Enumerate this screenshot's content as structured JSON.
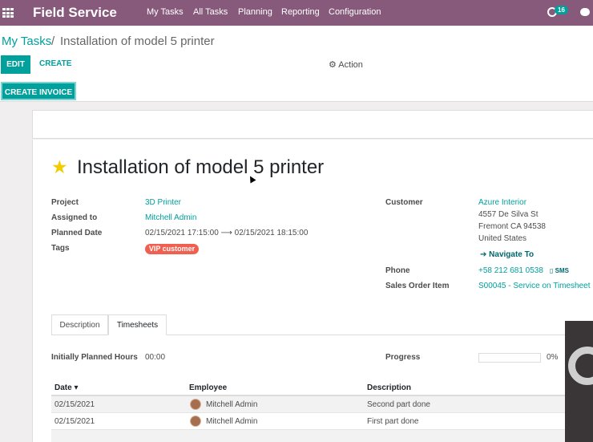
{
  "topbar": {
    "brand": "Field Service",
    "menu": [
      "My Tasks",
      "All Tasks",
      "Planning",
      "Reporting",
      "Configuration"
    ],
    "activity_count": "16"
  },
  "breadcrumb": {
    "parent": "My Tasks",
    "separator": "/",
    "current": "Installation of model 5 printer"
  },
  "buttons": {
    "edit": "EDIT",
    "create": "CREATE",
    "action": "⚙ Action",
    "create_invoice": "CREATE INVOICE"
  },
  "task": {
    "title": "Installation of model 5 printer",
    "fields_left": [
      {
        "label": "Project",
        "value": "3D Printer"
      },
      {
        "label": "Assigned to",
        "value": "Mitchell Admin"
      },
      {
        "label": "Planned Date",
        "value": "02/15/2021 17:15:00 ⟶ 02/15/2021 18:15:00"
      },
      {
        "label": "Tags",
        "value": "VIP customer"
      }
    ],
    "customer_label": "Customer",
    "customer_name": "Azure Interior",
    "address": [
      "4557 De Silva St",
      "Fremont CA 94538",
      "United States"
    ],
    "navigate": "➔ Navigate To",
    "phone_label": "Phone",
    "phone": "+58 212 681 0538",
    "sms": "SMS",
    "sales_order_label": "Sales Order Item",
    "sales_order": "S00045 - Service on Timesheet"
  },
  "tabs": [
    "Description",
    "Timesheets"
  ],
  "timesheets": {
    "planned_label": "Initially Planned Hours",
    "planned_value": "00:00",
    "progress_label": "Progress",
    "progress_value": "0%",
    "progress_fraction": 0,
    "columns": [
      "Date ▾",
      "Employee",
      "Description"
    ],
    "rows": [
      {
        "date": "02/15/2021",
        "employee": "Mitchell Admin",
        "description": "Second part done"
      },
      {
        "date": "02/15/2021",
        "employee": "Mitchell Admin",
        "description": "First part done"
      }
    ]
  },
  "colors": {
    "topbar": "#875a7b",
    "accent": "#00a09d",
    "tag": "#f06050",
    "star": "#f3cc00"
  }
}
